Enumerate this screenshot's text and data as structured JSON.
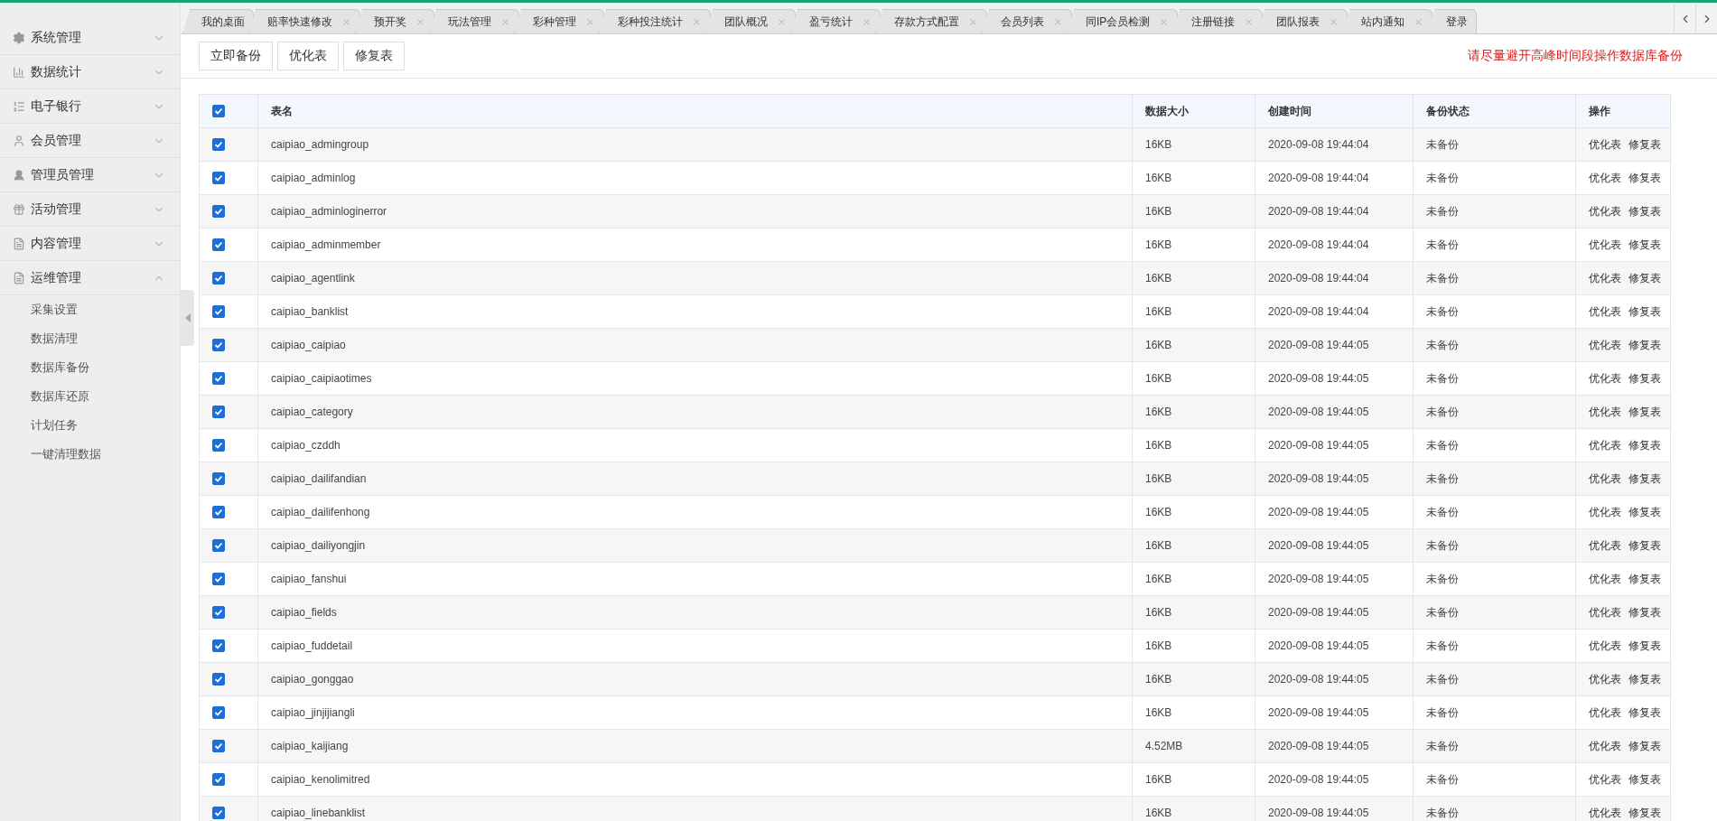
{
  "sidebar": {
    "items": [
      {
        "label": "系统管理",
        "expanded": false
      },
      {
        "label": "数据统计",
        "expanded": false
      },
      {
        "label": "电子银行",
        "expanded": false
      },
      {
        "label": "会员管理",
        "expanded": false
      },
      {
        "label": "管理员管理",
        "expanded": false
      },
      {
        "label": "活动管理",
        "expanded": false
      },
      {
        "label": "内容管理",
        "expanded": false
      },
      {
        "label": "运维管理",
        "expanded": true,
        "children": [
          {
            "label": "采集设置"
          },
          {
            "label": "数据清理"
          },
          {
            "label": "数据库备份"
          },
          {
            "label": "数据库还原"
          },
          {
            "label": "计划任务"
          },
          {
            "label": "一键清理数据"
          }
        ]
      }
    ]
  },
  "tabs": [
    {
      "label": "我的桌面",
      "closable": false,
      "selected": false
    },
    {
      "label": "赔率快速修改",
      "closable": true,
      "selected": false
    },
    {
      "label": "预开奖",
      "closable": true,
      "selected": false
    },
    {
      "label": "玩法管理",
      "closable": true,
      "selected": false
    },
    {
      "label": "彩种管理",
      "closable": true,
      "selected": false
    },
    {
      "label": "彩种投注统计",
      "closable": true,
      "selected": false
    },
    {
      "label": "团队概况",
      "closable": true,
      "selected": false
    },
    {
      "label": "盈亏统计",
      "closable": true,
      "selected": false
    },
    {
      "label": "存款方式配置",
      "closable": true,
      "selected": false
    },
    {
      "label": "会员列表",
      "closable": true,
      "selected": false
    },
    {
      "label": "同IP会员检测",
      "closable": true,
      "selected": false
    },
    {
      "label": "注册链接",
      "closable": true,
      "selected": false
    },
    {
      "label": "团队报表",
      "closable": true,
      "selected": false
    },
    {
      "label": "站内通知",
      "closable": true,
      "selected": false
    },
    {
      "label": "登录",
      "closable": false,
      "selected": false
    }
  ],
  "toolbar": {
    "buttons": [
      "立即备份",
      "优化表",
      "修复表"
    ],
    "notice": "请尽量避开高峰时间段操作数据库备份"
  },
  "table": {
    "all_checked": true,
    "columns": [
      "表名",
      "数据大小",
      "创建时间",
      "备份状态",
      "操作"
    ],
    "rows": [
      {
        "checked": true,
        "name": "caipiao_admingroup",
        "size": "16KB",
        "created": "2020-09-08 19:44:04",
        "status": "未备份",
        "actions": [
          "优化表",
          "修复表"
        ]
      },
      {
        "checked": true,
        "name": "caipiao_adminlog",
        "size": "16KB",
        "created": "2020-09-08 19:44:04",
        "status": "未备份",
        "actions": [
          "优化表",
          "修复表"
        ]
      },
      {
        "checked": true,
        "name": "caipiao_adminloginerror",
        "size": "16KB",
        "created": "2020-09-08 19:44:04",
        "status": "未备份",
        "actions": [
          "优化表",
          "修复表"
        ]
      },
      {
        "checked": true,
        "name": "caipiao_adminmember",
        "size": "16KB",
        "created": "2020-09-08 19:44:04",
        "status": "未备份",
        "actions": [
          "优化表",
          "修复表"
        ]
      },
      {
        "checked": true,
        "name": "caipiao_agentlink",
        "size": "16KB",
        "created": "2020-09-08 19:44:04",
        "status": "未备份",
        "actions": [
          "优化表",
          "修复表"
        ]
      },
      {
        "checked": true,
        "name": "caipiao_banklist",
        "size": "16KB",
        "created": "2020-09-08 19:44:04",
        "status": "未备份",
        "actions": [
          "优化表",
          "修复表"
        ]
      },
      {
        "checked": true,
        "name": "caipiao_caipiao",
        "size": "16KB",
        "created": "2020-09-08 19:44:05",
        "status": "未备份",
        "actions": [
          "优化表",
          "修复表"
        ]
      },
      {
        "checked": true,
        "name": "caipiao_caipiaotimes",
        "size": "16KB",
        "created": "2020-09-08 19:44:05",
        "status": "未备份",
        "actions": [
          "优化表",
          "修复表"
        ]
      },
      {
        "checked": true,
        "name": "caipiao_category",
        "size": "16KB",
        "created": "2020-09-08 19:44:05",
        "status": "未备份",
        "actions": [
          "优化表",
          "修复表"
        ]
      },
      {
        "checked": true,
        "name": "caipiao_czddh",
        "size": "16KB",
        "created": "2020-09-08 19:44:05",
        "status": "未备份",
        "actions": [
          "优化表",
          "修复表"
        ]
      },
      {
        "checked": true,
        "name": "caipiao_dailifandian",
        "size": "16KB",
        "created": "2020-09-08 19:44:05",
        "status": "未备份",
        "actions": [
          "优化表",
          "修复表"
        ]
      },
      {
        "checked": true,
        "name": "caipiao_dailifenhong",
        "size": "16KB",
        "created": "2020-09-08 19:44:05",
        "status": "未备份",
        "actions": [
          "优化表",
          "修复表"
        ]
      },
      {
        "checked": true,
        "name": "caipiao_dailiyongjin",
        "size": "16KB",
        "created": "2020-09-08 19:44:05",
        "status": "未备份",
        "actions": [
          "优化表",
          "修复表"
        ]
      },
      {
        "checked": true,
        "name": "caipiao_fanshui",
        "size": "16KB",
        "created": "2020-09-08 19:44:05",
        "status": "未备份",
        "actions": [
          "优化表",
          "修复表"
        ]
      },
      {
        "checked": true,
        "name": "caipiao_fields",
        "size": "16KB",
        "created": "2020-09-08 19:44:05",
        "status": "未备份",
        "actions": [
          "优化表",
          "修复表"
        ]
      },
      {
        "checked": true,
        "name": "caipiao_fuddetail",
        "size": "16KB",
        "created": "2020-09-08 19:44:05",
        "status": "未备份",
        "actions": [
          "优化表",
          "修复表"
        ]
      },
      {
        "checked": true,
        "name": "caipiao_gonggao",
        "size": "16KB",
        "created": "2020-09-08 19:44:05",
        "status": "未备份",
        "actions": [
          "优化表",
          "修复表"
        ]
      },
      {
        "checked": true,
        "name": "caipiao_jinjijiangli",
        "size": "16KB",
        "created": "2020-09-08 19:44:05",
        "status": "未备份",
        "actions": [
          "优化表",
          "修复表"
        ]
      },
      {
        "checked": true,
        "name": "caipiao_kaijiang",
        "size": "4.52MB",
        "created": "2020-09-08 19:44:05",
        "status": "未备份",
        "actions": [
          "优化表",
          "修复表"
        ]
      },
      {
        "checked": true,
        "name": "caipiao_kenolimitred",
        "size": "16KB",
        "created": "2020-09-08 19:44:05",
        "status": "未备份",
        "actions": [
          "优化表",
          "修复表"
        ]
      },
      {
        "checked": true,
        "name": "caipiao_linebanklist",
        "size": "16KB",
        "created": "2020-09-08 19:44:05",
        "status": "未备份",
        "actions": [
          "优化表",
          "修复表"
        ]
      }
    ]
  }
}
